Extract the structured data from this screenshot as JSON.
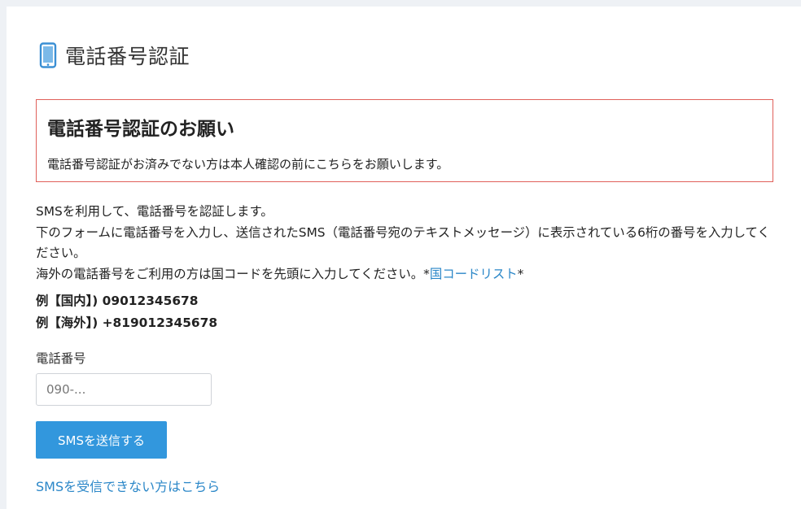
{
  "page": {
    "title": "電話番号認証",
    "icon": "smartphone-icon",
    "accent_color": "#3297dd",
    "link_color": "#2b87c8",
    "notice_border_color": "#e0605a"
  },
  "notice": {
    "title": "電話番号認証のお願い",
    "text": "電話番号認証がお済みでない方は本人確認の前にこちらをお願いします。"
  },
  "description": {
    "line1": "SMSを利用して、電話番号を認証します。",
    "line2": "下のフォームに電話番号を入力し、送信されたSMS（電話番号宛のテキストメッセージ）に表示されている6桁の番号を入力してください。",
    "line3_prefix": "海外の電話番号をご利用の方は国コードを先頭に入力してください。*",
    "country_list_link": "国コードリスト",
    "line3_suffix": "*"
  },
  "examples": {
    "domestic": "例【国内】) 09012345678",
    "overseas": "例【海外】) +819012345678"
  },
  "form": {
    "phone_label": "電話番号",
    "phone_placeholder": "090-...",
    "phone_value": "",
    "submit_label": "SMSを送信する"
  },
  "help": {
    "link_text": "SMSを受信できない方はこちら"
  }
}
